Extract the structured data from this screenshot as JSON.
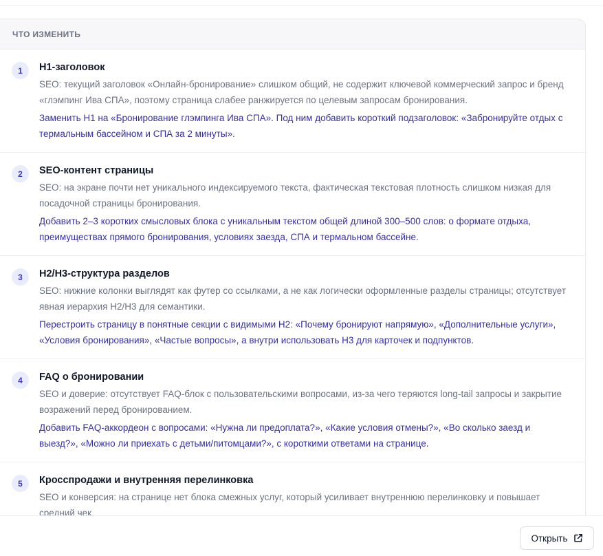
{
  "section": {
    "header": "ЧТО ИЗМЕНИТЬ"
  },
  "items": [
    {
      "num": "1",
      "title": "H1-заголовок",
      "desc": "SEO: текущий заголовок «Онлайн-бронирование» слишком общий, не содержит ключевой коммерческий запрос и бренд «глэмпинг Ива СПА», поэтому страница слабее ранжируется по целевым запросам бронирования.",
      "action": "Заменить H1 на «Бронирование глэмпинга Ива СПА». Под ним добавить короткий подзаголовок: «Забронируйте отдых с термальным бассейном и СПА за 2 минуты»."
    },
    {
      "num": "2",
      "title": "SEO-контент страницы",
      "desc": "SEO: на экране почти нет уникального индексируемого текста, фактическая текстовая плотность слишком низкая для посадочной страницы бронирования.",
      "action": "Добавить 2–3 коротких смысловых блока с уникальным текстом общей длиной 300–500 слов: о формате отдыха, преимуществах прямого бронирования, условиях заезда, СПА и термальном бассейне."
    },
    {
      "num": "3",
      "title": "H2/H3-структура разделов",
      "desc": "SEO: нижние колонки выглядят как футер со ссылками, а не как логически оформленные разделы страницы; отсутствует явная иерархия H2/H3 для семантики.",
      "action": "Перестроить страницу в понятные секции с видимыми H2: «Почему бронируют напрямую», «Дополнительные услуги», «Условия бронирования», «Частые вопросы», а внутри использовать H3 для карточек и подпунктов."
    },
    {
      "num": "4",
      "title": "FAQ о бронировании",
      "desc": "SEO и доверие: отсутствует FAQ-блок с пользовательскими вопросами, из-за чего теряются long-tail запросы и закрытие возражений перед бронированием.",
      "action": "Добавить FAQ-аккордеон с вопросами: «Нужна ли предоплата?», «Какие условия отмены?», «Во сколько заезд и выезд?», «Можно ли приехать с детьми/питомцами?», с короткими ответами на странице."
    },
    {
      "num": "5",
      "title": "Кросспродажи и внутренняя перелинковка",
      "desc": "SEO и конверсия: на странице нет блока смежных услуг, который усиливает внутреннюю перелинковку и повышает средний чек.",
      "action": ""
    }
  ],
  "footer": {
    "open_label": "Открыть",
    "open_icon": "external-link-icon"
  },
  "colors": {
    "accent": "#3730a3",
    "badge_bg": "#e9ecfb",
    "muted_text": "#6b7280"
  }
}
